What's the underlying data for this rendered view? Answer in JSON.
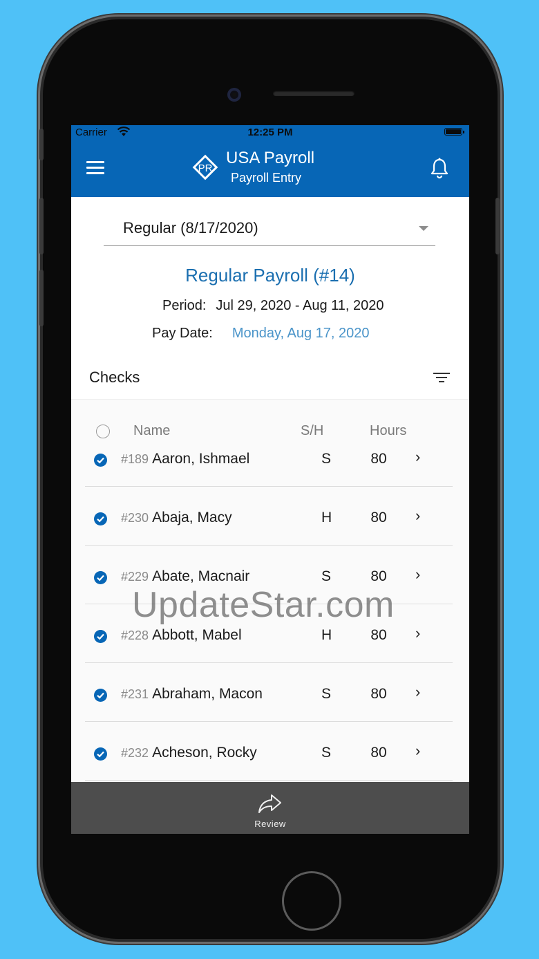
{
  "status": {
    "carrier": "Carrier",
    "time": "12:25 PM"
  },
  "header": {
    "logo_text": "PR",
    "title": "USA Payroll",
    "subtitle": "Payroll Entry"
  },
  "payroll_select": {
    "value": "Regular (8/17/2020)"
  },
  "payroll": {
    "title": "Regular Payroll (#14)",
    "period_label": "Period:",
    "period_value": "Jul 29, 2020 - Aug 11, 2020",
    "paydate_label": "Pay Date:",
    "paydate_value": "Monday, Aug 17, 2020"
  },
  "checks": {
    "title": "Checks",
    "columns": {
      "name": "Name",
      "sh": "S/H",
      "hours": "Hours"
    },
    "rows": [
      {
        "num": "#189",
        "name": "Aaron, Ishmael",
        "sh": "S",
        "hours": "80"
      },
      {
        "num": "#230",
        "name": "Abaja, Macy",
        "sh": "H",
        "hours": "80"
      },
      {
        "num": "#229",
        "name": "Abate, Macnair",
        "sh": "S",
        "hours": "80"
      },
      {
        "num": "#228",
        "name": "Abbott, Mabel",
        "sh": "H",
        "hours": "80"
      },
      {
        "num": "#231",
        "name": "Abraham, Macon",
        "sh": "S",
        "hours": "80"
      },
      {
        "num": "#232",
        "name": "Acheson, Rocky",
        "sh": "S",
        "hours": "80"
      }
    ]
  },
  "bottom": {
    "review_label": "Review"
  },
  "watermark": "UpdateStar.com",
  "colors": {
    "background": "#4fc1f7",
    "brand": "#0766b6",
    "bottom_bar": "#4d4d4d"
  }
}
